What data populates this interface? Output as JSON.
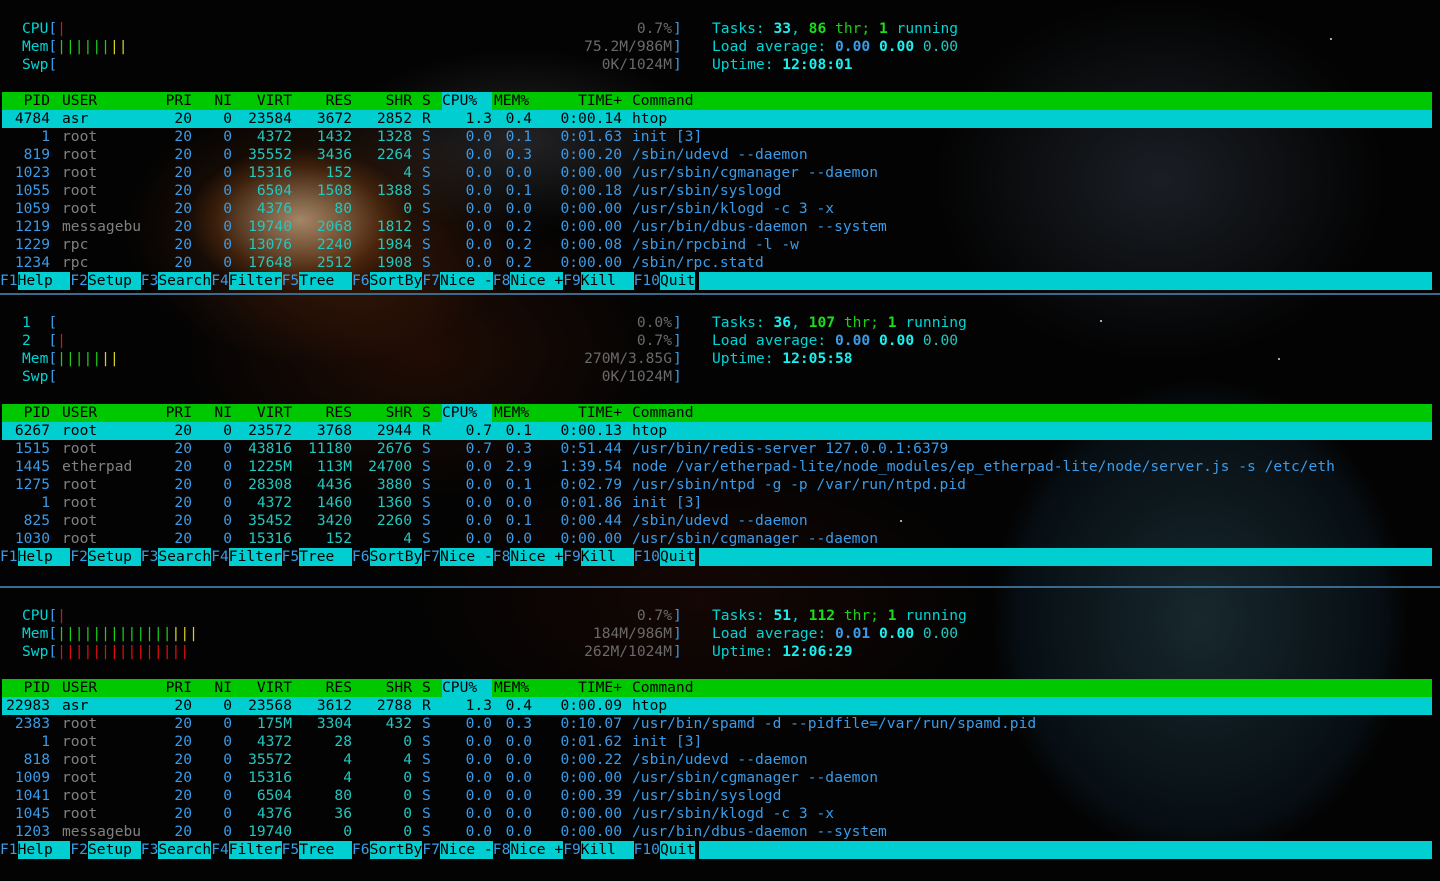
{
  "columns": [
    "PID",
    "USER",
    "PRI",
    "NI",
    "VIRT",
    "RES",
    "SHR",
    "S",
    "CPU%",
    "MEM%",
    "TIME+",
    "Command"
  ],
  "function_keys": [
    {
      "key": "F1",
      "label": "Help  "
    },
    {
      "key": "F2",
      "label": "Setup "
    },
    {
      "key": "F3",
      "label": "Search"
    },
    {
      "key": "F4",
      "label": "Filter"
    },
    {
      "key": "F5",
      "label": "Tree  "
    },
    {
      "key": "F6",
      "label": "SortBy"
    },
    {
      "key": "F7",
      "label": "Nice -"
    },
    {
      "key": "F8",
      "label": "Nice +"
    },
    {
      "key": "F9",
      "label": "Kill  "
    },
    {
      "key": "F10",
      "label": "Quit"
    }
  ],
  "panels": [
    {
      "meters": [
        {
          "label": "CPU",
          "bars": [
            {
              "color": "red",
              "count": 1
            }
          ],
          "value": "0.7%"
        },
        {
          "label": "Mem",
          "bars": [
            {
              "color": "green",
              "count": 6
            },
            {
              "color": "yellow",
              "count": 2
            }
          ],
          "value": "75.2M/986M"
        },
        {
          "label": "Swp",
          "bars": [],
          "value": "0K/1024M"
        }
      ],
      "tasks": {
        "label": "Tasks: ",
        "count": "33",
        "sep": ", ",
        "threads": "86",
        "thr_label": " thr; ",
        "running": "1",
        "running_label": " running"
      },
      "load": {
        "label": "Load average: ",
        "one": "0.00",
        "five": "0.00",
        "fifteen": "0.00"
      },
      "uptime": {
        "label": "Uptime: ",
        "value": "12:08:01"
      },
      "processes": [
        {
          "pid": "4784",
          "user": "asr",
          "pri": "20",
          "ni": "0",
          "virt": "23584",
          "res": "3672",
          "shr": "2852",
          "s": "R",
          "cpu": "1.3",
          "mem": "0.4",
          "time": "0:00.14",
          "command": "htop",
          "selected": true
        },
        {
          "pid": "1",
          "user": "root",
          "pri": "20",
          "ni": "0",
          "virt": "4372",
          "res": "1432",
          "shr": "1328",
          "s": "S",
          "cpu": "0.0",
          "mem": "0.1",
          "time": "0:01.63",
          "command": "init [3]"
        },
        {
          "pid": "819",
          "user": "root",
          "pri": "20",
          "ni": "0",
          "virt": "35552",
          "res": "3436",
          "shr": "2264",
          "s": "S",
          "cpu": "0.0",
          "mem": "0.3",
          "time": "0:00.20",
          "command": "/sbin/udevd --daemon"
        },
        {
          "pid": "1023",
          "user": "root",
          "pri": "20",
          "ni": "0",
          "virt": "15316",
          "res": "152",
          "shr": "4",
          "s": "S",
          "cpu": "0.0",
          "mem": "0.0",
          "time": "0:00.00",
          "command": "/usr/sbin/cgmanager --daemon"
        },
        {
          "pid": "1055",
          "user": "root",
          "pri": "20",
          "ni": "0",
          "virt": "6504",
          "res": "1508",
          "shr": "1388",
          "s": "S",
          "cpu": "0.0",
          "mem": "0.1",
          "time": "0:00.18",
          "command": "/usr/sbin/syslogd"
        },
        {
          "pid": "1059",
          "user": "root",
          "pri": "20",
          "ni": "0",
          "virt": "4376",
          "res": "80",
          "shr": "0",
          "s": "S",
          "cpu": "0.0",
          "mem": "0.0",
          "time": "0:00.00",
          "command": "/usr/sbin/klogd -c 3 -x"
        },
        {
          "pid": "1219",
          "user": "messagebu",
          "pri": "20",
          "ni": "0",
          "virt": "19740",
          "res": "2068",
          "shr": "1812",
          "s": "S",
          "cpu": "0.0",
          "mem": "0.2",
          "time": "0:00.00",
          "command": "/usr/bin/dbus-daemon --system"
        },
        {
          "pid": "1229",
          "user": "rpc",
          "pri": "20",
          "ni": "0",
          "virt": "13076",
          "res": "2240",
          "shr": "1984",
          "s": "S",
          "cpu": "0.0",
          "mem": "0.2",
          "time": "0:00.08",
          "command": "/sbin/rpcbind -l -w"
        },
        {
          "pid": "1234",
          "user": "rpc",
          "pri": "20",
          "ni": "0",
          "virt": "17648",
          "res": "2512",
          "shr": "1908",
          "s": "S",
          "cpu": "0.0",
          "mem": "0.2",
          "time": "0:00.00",
          "command": "/sbin/rpc.statd"
        }
      ]
    },
    {
      "meters": [
        {
          "label": "1  ",
          "bars": [],
          "value": "0.0%"
        },
        {
          "label": "2  ",
          "bars": [
            {
              "color": "red",
              "count": 1
            }
          ],
          "value": "0.7%"
        },
        {
          "label": "Mem",
          "bars": [
            {
              "color": "green",
              "count": 5
            },
            {
              "color": "yellow",
              "count": 2
            }
          ],
          "value": "270M/3.85G"
        },
        {
          "label": "Swp",
          "bars": [],
          "value": "0K/1024M"
        }
      ],
      "tasks": {
        "label": "Tasks: ",
        "count": "36",
        "sep": ", ",
        "threads": "107",
        "thr_label": " thr; ",
        "running": "1",
        "running_label": " running"
      },
      "load": {
        "label": "Load average: ",
        "one": "0.00",
        "five": "0.00",
        "fifteen": "0.00"
      },
      "uptime": {
        "label": "Uptime: ",
        "value": "12:05:58"
      },
      "processes": [
        {
          "pid": "6267",
          "user": "root",
          "pri": "20",
          "ni": "0",
          "virt": "23572",
          "res": "3768",
          "shr": "2944",
          "s": "R",
          "cpu": "0.7",
          "mem": "0.1",
          "time": "0:00.13",
          "command": "htop",
          "selected": true
        },
        {
          "pid": "1515",
          "user": "root",
          "pri": "20",
          "ni": "0",
          "virt": "43816",
          "res": "11180",
          "shr": "2676",
          "s": "S",
          "cpu": "0.7",
          "mem": "0.3",
          "time": "0:51.44",
          "command": "/usr/bin/redis-server 127.0.0.1:6379"
        },
        {
          "pid": "1445",
          "user": "etherpad",
          "pri": "20",
          "ni": "0",
          "virt": "1225M",
          "res": "113M",
          "shr": "24700",
          "s": "S",
          "cpu": "0.0",
          "mem": "2.9",
          "time": "1:39.54",
          "command": "node /var/etherpad-lite/node_modules/ep_etherpad-lite/node/server.js -s /etc/eth"
        },
        {
          "pid": "1275",
          "user": "root",
          "pri": "20",
          "ni": "0",
          "virt": "28308",
          "res": "4436",
          "shr": "3880",
          "s": "S",
          "cpu": "0.0",
          "mem": "0.1",
          "time": "0:02.79",
          "command": "/usr/sbin/ntpd -g -p /var/run/ntpd.pid"
        },
        {
          "pid": "1",
          "user": "root",
          "pri": "20",
          "ni": "0",
          "virt": "4372",
          "res": "1460",
          "shr": "1360",
          "s": "S",
          "cpu": "0.0",
          "mem": "0.0",
          "time": "0:01.86",
          "command": "init [3]"
        },
        {
          "pid": "825",
          "user": "root",
          "pri": "20",
          "ni": "0",
          "virt": "35452",
          "res": "3420",
          "shr": "2260",
          "s": "S",
          "cpu": "0.0",
          "mem": "0.1",
          "time": "0:00.44",
          "command": "/sbin/udevd --daemon"
        },
        {
          "pid": "1030",
          "user": "root",
          "pri": "20",
          "ni": "0",
          "virt": "15316",
          "res": "152",
          "shr": "4",
          "s": "S",
          "cpu": "0.0",
          "mem": "0.0",
          "time": "0:00.00",
          "command": "/usr/sbin/cgmanager --daemon"
        }
      ]
    },
    {
      "meters": [
        {
          "label": "CPU",
          "bars": [
            {
              "color": "red",
              "count": 1
            }
          ],
          "value": "0.7%"
        },
        {
          "label": "Mem",
          "bars": [
            {
              "color": "green",
              "count": 13
            },
            {
              "color": "yellow",
              "count": 3
            }
          ],
          "value": "184M/986M"
        },
        {
          "label": "Swp",
          "bars": [
            {
              "color": "red",
              "count": 15
            }
          ],
          "value": "262M/1024M"
        }
      ],
      "tasks": {
        "label": "Tasks: ",
        "count": "51",
        "sep": ", ",
        "threads": "112",
        "thr_label": " thr; ",
        "running": "1",
        "running_label": " running"
      },
      "load": {
        "label": "Load average: ",
        "one": "0.01",
        "five": "0.00",
        "fifteen": "0.00"
      },
      "uptime": {
        "label": "Uptime: ",
        "value": "12:06:29"
      },
      "processes": [
        {
          "pid": "22983",
          "user": "asr",
          "pri": "20",
          "ni": "0",
          "virt": "23568",
          "res": "3612",
          "shr": "2788",
          "s": "R",
          "cpu": "1.3",
          "mem": "0.4",
          "time": "0:00.09",
          "command": "htop",
          "selected": true
        },
        {
          "pid": "2383",
          "user": "root",
          "pri": "20",
          "ni": "0",
          "virt": "175M",
          "res": "3304",
          "shr": "432",
          "s": "S",
          "cpu": "0.0",
          "mem": "0.3",
          "time": "0:10.07",
          "command": "/usr/bin/spamd -d --pidfile=/var/run/spamd.pid"
        },
        {
          "pid": "1",
          "user": "root",
          "pri": "20",
          "ni": "0",
          "virt": "4372",
          "res": "28",
          "shr": "0",
          "s": "S",
          "cpu": "0.0",
          "mem": "0.0",
          "time": "0:01.62",
          "command": "init [3]"
        },
        {
          "pid": "818",
          "user": "root",
          "pri": "20",
          "ni": "0",
          "virt": "35572",
          "res": "4",
          "shr": "4",
          "s": "S",
          "cpu": "0.0",
          "mem": "0.0",
          "time": "0:00.22",
          "command": "/sbin/udevd --daemon"
        },
        {
          "pid": "1009",
          "user": "root",
          "pri": "20",
          "ni": "0",
          "virt": "15316",
          "res": "4",
          "shr": "0",
          "s": "S",
          "cpu": "0.0",
          "mem": "0.0",
          "time": "0:00.00",
          "command": "/usr/sbin/cgmanager --daemon"
        },
        {
          "pid": "1041",
          "user": "root",
          "pri": "20",
          "ni": "0",
          "virt": "6504",
          "res": "80",
          "shr": "0",
          "s": "S",
          "cpu": "0.0",
          "mem": "0.0",
          "time": "0:00.39",
          "command": "/usr/sbin/syslogd"
        },
        {
          "pid": "1045",
          "user": "root",
          "pri": "20",
          "ni": "0",
          "virt": "4376",
          "res": "36",
          "shr": "0",
          "s": "S",
          "cpu": "0.0",
          "mem": "0.0",
          "time": "0:00.00",
          "command": "/usr/sbin/klogd -c 3 -x"
        },
        {
          "pid": "1203",
          "user": "messagebu",
          "pri": "20",
          "ni": "0",
          "virt": "19740",
          "res": "0",
          "shr": "0",
          "s": "S",
          "cpu": "0.0",
          "mem": "0.0",
          "time": "0:00.00",
          "command": "/usr/bin/dbus-daemon --system"
        }
      ]
    }
  ]
}
